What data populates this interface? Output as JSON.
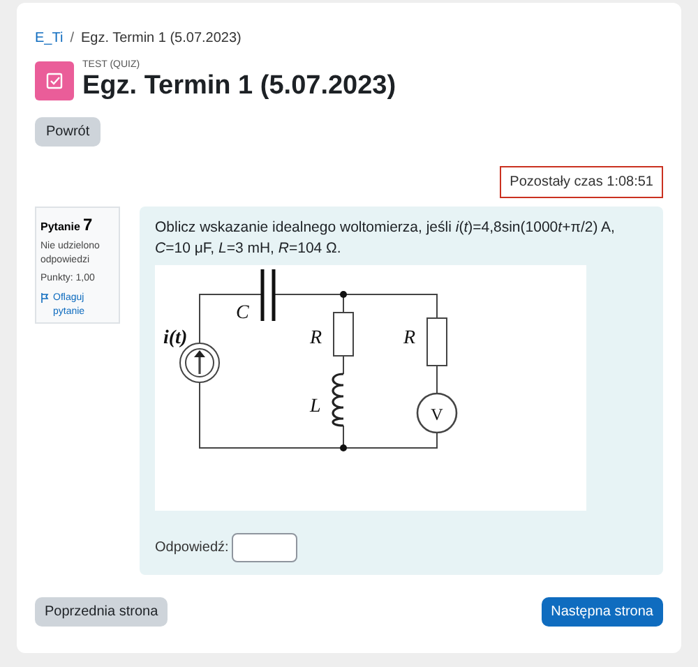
{
  "breadcrumb": [
    {
      "label": "E_Ti",
      "link": true
    },
    {
      "label": "Egz. Termin 1 (5.07.2023)",
      "link": false
    }
  ],
  "breadcrumb_separator": "/",
  "header": {
    "kind_label": "TEST (QUIZ)",
    "title": "Egz. Termin 1 (5.07.2023)"
  },
  "back_button": "Powrót",
  "timer": "Pozostały czas 1:08:51",
  "question_info": {
    "label": "Pytanie",
    "number": "7",
    "status": "Nie udzielono odpowiedzi",
    "points": "Punkty: 1,00",
    "flag": "Oflaguj pytanie"
  },
  "question": {
    "text": [
      {
        "text": "Oblicz wskazanie idealnego woltomierza, jeśli ",
        "italic": false
      },
      {
        "text": "i",
        "italic": true
      },
      {
        "text": "(",
        "italic": false
      },
      {
        "text": "t",
        "italic": true
      },
      {
        "text": ")=4,8sin(1000",
        "italic": false
      },
      {
        "text": "t",
        "italic": true
      },
      {
        "text": "+π/2) A,  ",
        "italic": false
      },
      {
        "text": "C",
        "italic": true
      },
      {
        "text": "=10 μF, ",
        "italic": false
      },
      {
        "text": "L",
        "italic": true
      },
      {
        "text": "=3 mH, ",
        "italic": false
      },
      {
        "text": "R",
        "italic": true
      },
      {
        "text": "=104 Ω.",
        "italic": false
      }
    ],
    "circuit_labels": {
      "source": "i(t)",
      "capacitor": "C",
      "resistor_1": "R",
      "inductor": "L",
      "resistor_2": "R",
      "meter": "V"
    },
    "answer_label": "Odpowiedź:"
  },
  "nav": {
    "previous": "Poprzednia strona",
    "next": "Następna strona"
  }
}
